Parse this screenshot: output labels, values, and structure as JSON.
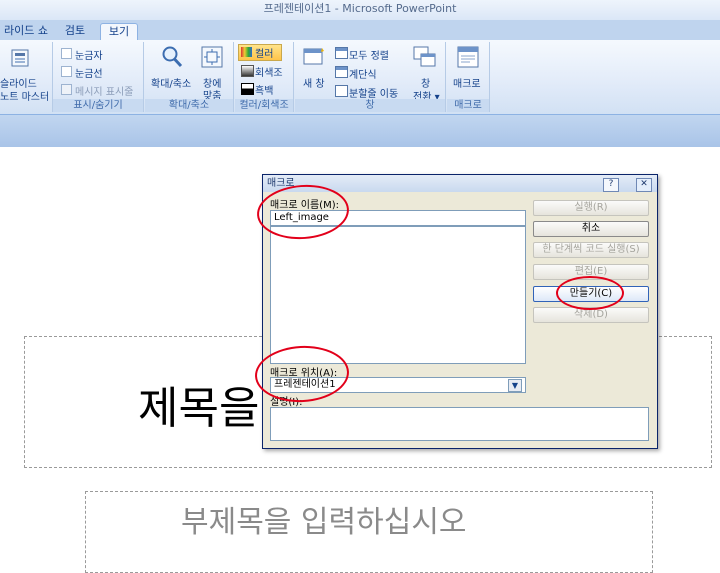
{
  "window": {
    "title": "프레젠테이션1 - Microsoft PowerPoint"
  },
  "tabs": [
    {
      "label": "라이드 쇼"
    },
    {
      "label": "검토"
    },
    {
      "label": "보기"
    }
  ],
  "ribbon": {
    "views": {
      "slide_master_line1": "슬라이드",
      "slide_master_line2": "노트 마스터"
    },
    "show_hide": {
      "ruler": "눈금자",
      "gridlines": "눈금선",
      "message_bar": "메시지 표시줄",
      "group_label": "표시/숨기기"
    },
    "zoom": {
      "zoom_label": "확대/축소",
      "fit_line1": "창에",
      "fit_line2": "맞춤",
      "group_label": "확대/축소"
    },
    "color": {
      "color": "컬러",
      "grayscale": "회색조",
      "bw": "흑백",
      "group_label": "컬러/회색조"
    },
    "window": {
      "new_window": "새 창",
      "arrange_all": "모두 정렬",
      "cascade": "계단식",
      "move_split": "분할줄 이동",
      "switch_line1": "창",
      "switch_line2": "전환 ▾",
      "group_label": "창"
    },
    "macros": {
      "macros": "매크로",
      "group_label": "매크로"
    }
  },
  "slide": {
    "title_placeholder_visible": "제목을",
    "subtitle_placeholder": "부제목을 입력하십시오"
  },
  "dialog": {
    "title": "매크로",
    "help_glyph": "?",
    "close_glyph": "✕",
    "macro_name_label": "매크로 이름(M):",
    "macro_name_value": "Left_image",
    "macro_location_label": "매크로 위치(A):",
    "macro_location_value": "프레젠테이션1",
    "description_label": "설명(I):",
    "buttons": {
      "run": "실행(R)",
      "cancel": "취소",
      "step_into": "한 단계씩 코드 실행(S)",
      "edit": "편집(E)",
      "create": "만들기(C)",
      "delete": "삭제(D)"
    }
  }
}
